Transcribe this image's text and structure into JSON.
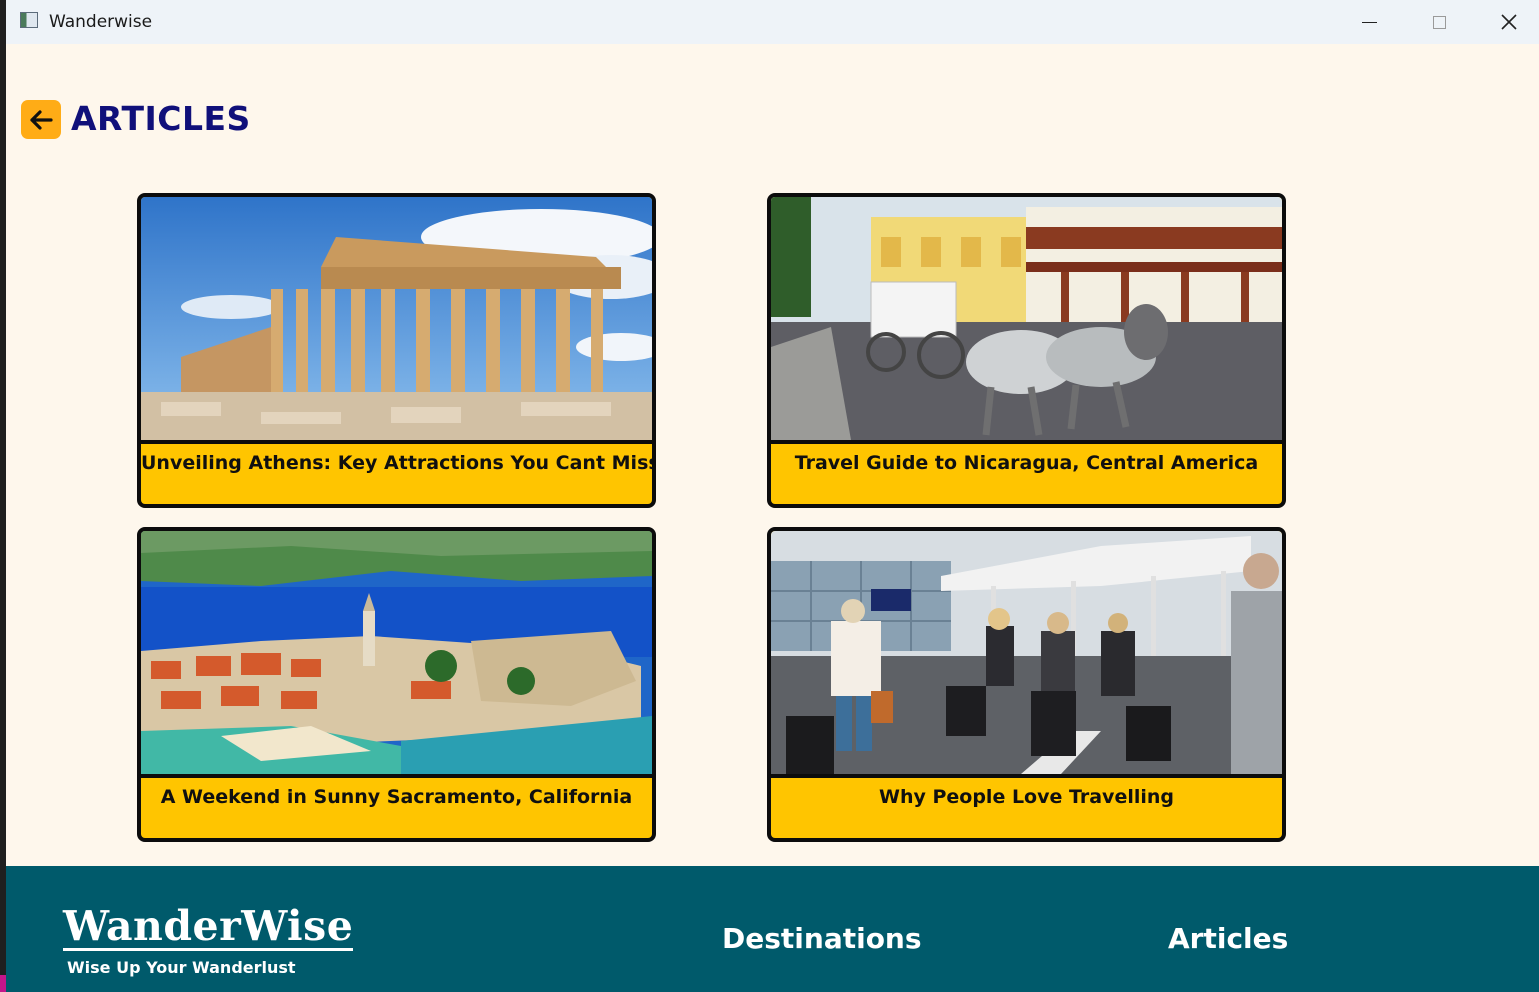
{
  "window": {
    "title": "Wanderwise"
  },
  "page": {
    "heading": "ARTICLES"
  },
  "articles": [
    {
      "title": "Unveiling Athens: Key Attractions You Cant Miss"
    },
    {
      "title": "Travel Guide to Nicaragua, Central America"
    },
    {
      "title": "A Weekend in Sunny Sacramento, California"
    },
    {
      "title": "Why People Love Travelling"
    }
  ],
  "footer": {
    "brand": "WanderWise",
    "tagline": "Wise Up Your Wanderlust",
    "links": [
      "Destinations",
      "Articles"
    ]
  },
  "colors": {
    "background": "#fef7ec",
    "accent": "#ffc500",
    "back_button": "#ffac16",
    "heading": "#10107a",
    "footer": "#005a6b"
  },
  "icons": {
    "back": "arrow-left-icon",
    "app": "app-window-icon",
    "minimize": "minimize-icon",
    "maximize": "maximize-icon",
    "close": "close-icon"
  }
}
